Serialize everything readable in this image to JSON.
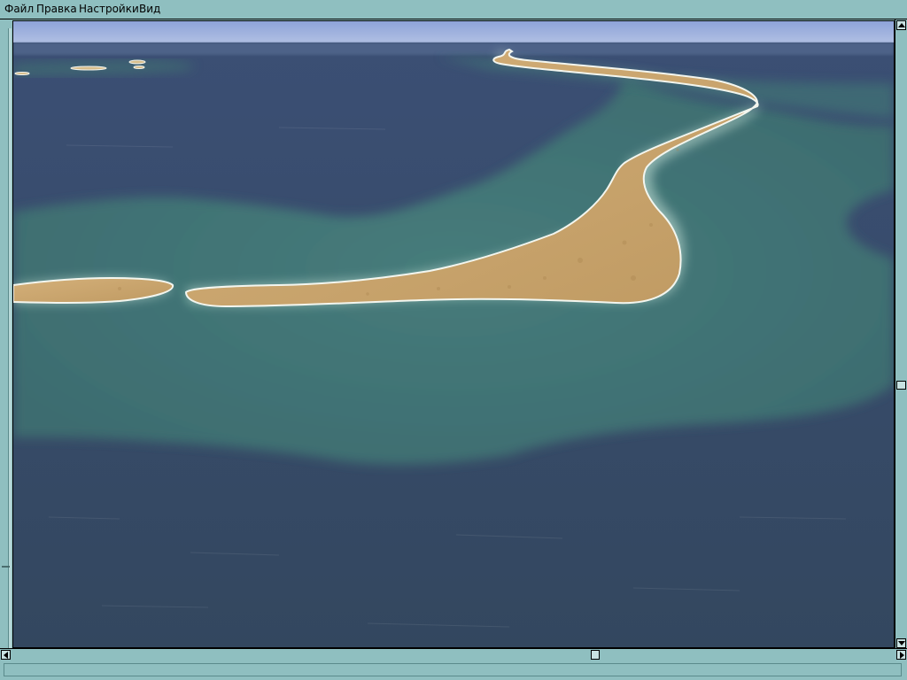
{
  "menu": {
    "items": [
      {
        "label": "Файл"
      },
      {
        "label": "Правка"
      },
      {
        "label": "Настройки"
      },
      {
        "label": "Вид"
      }
    ]
  },
  "scene": {
    "description_icon": "terrain-viewport",
    "colors": {
      "sky": "#9aaedd",
      "deep_water": "#364a6b",
      "shallow_water": "#3f7273",
      "sand": "#c9a56d",
      "surf": "#dfeee6"
    }
  },
  "statusbar": {
    "text": ""
  },
  "colors": {
    "chrome": "#8fbfc0",
    "chrome_light": "#c8e2e2"
  }
}
